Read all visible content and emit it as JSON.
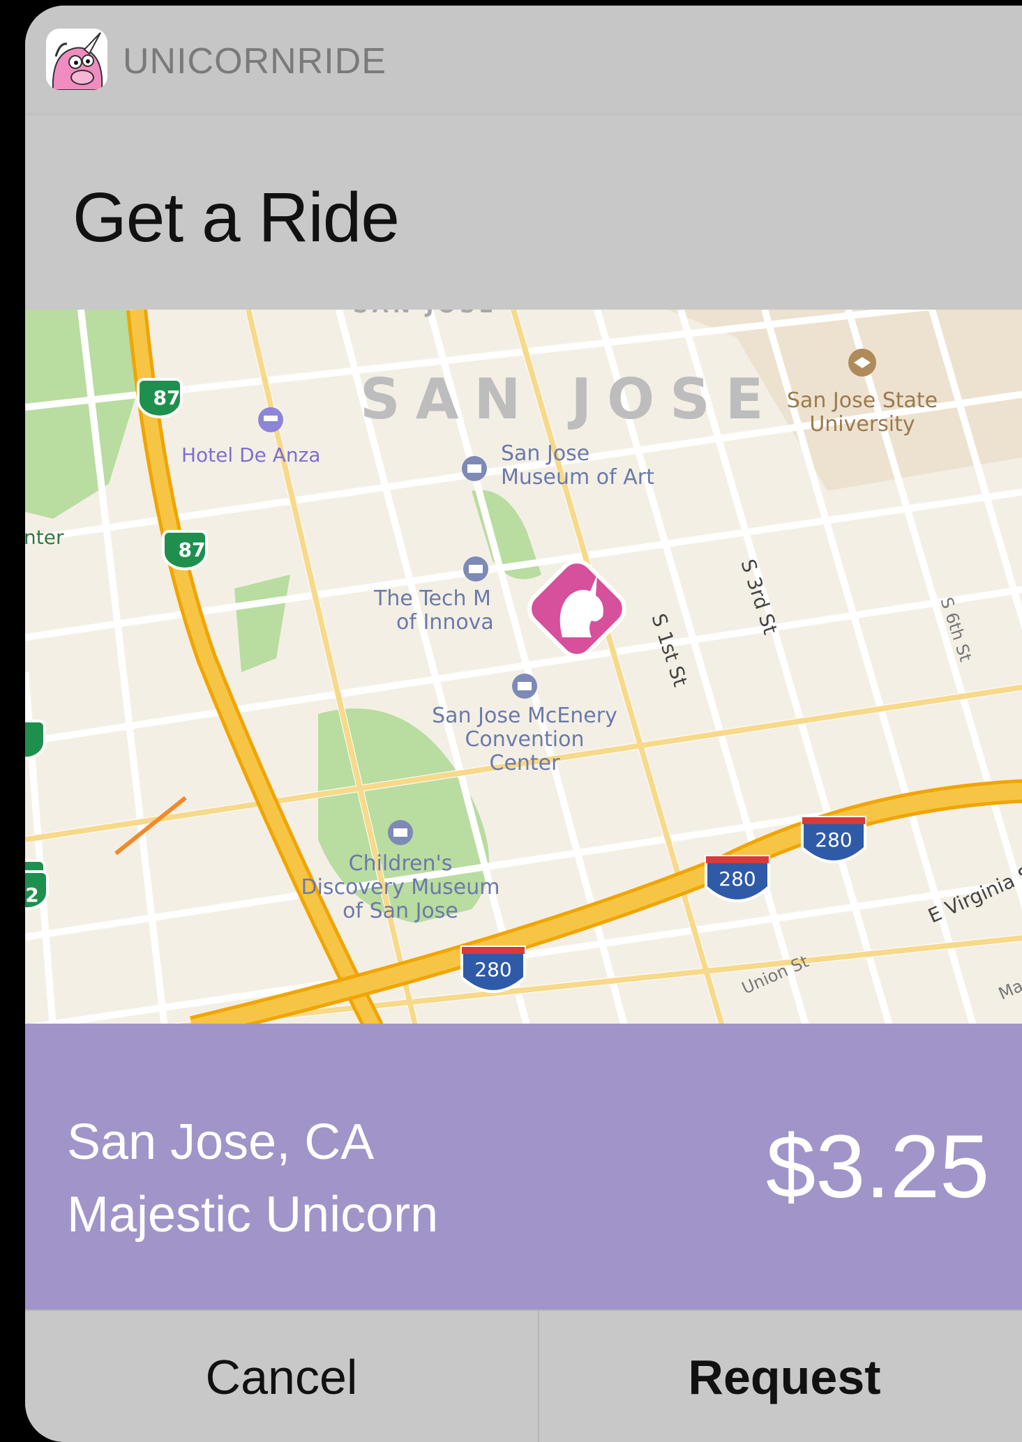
{
  "app": {
    "name": "UNICORNRIDE",
    "icon": "unicorn-app-icon"
  },
  "header": {
    "title": "Get a Ride"
  },
  "map": {
    "city_label": "SAN JOSE",
    "city_label_top": "SAN JOSE",
    "partial_label_left": "nter",
    "pois": {
      "hotel": "Hotel De Anza",
      "museum_art": [
        "San Jose",
        "Museum of Art"
      ],
      "tech": [
        "The Tech M",
        "of Innova"
      ],
      "convention": [
        "San Jose McEnery",
        "Convention",
        "Center"
      ],
      "childrens": [
        "Children's",
        "Discovery Museum",
        "of San Jose"
      ],
      "university": [
        "San Jose State",
        "University"
      ]
    },
    "streets": {
      "s1st": "S 1st St",
      "s3rd": "S 3rd St",
      "s6th": "S 6th St",
      "union": "Union St",
      "virginia": "E Virginia S",
      "mart": "Mart"
    },
    "shields": {
      "hwy87_a": "87",
      "hwy87_b": "87",
      "hwy_partial": "2",
      "i280_a": "280",
      "i280_b": "280",
      "i280_c": "280"
    },
    "marker_icon": "unicorn-marker-icon"
  },
  "ride": {
    "location": "San Jose, CA",
    "vehicle": "Majestic Unicorn",
    "price": "$3.25"
  },
  "actions": {
    "cancel": "Cancel",
    "request": "Request"
  },
  "colors": {
    "info_bg": "#a194c9",
    "marker": "#d6509c",
    "highway": "#f7c545",
    "header_bg": "#c6c6c6"
  }
}
